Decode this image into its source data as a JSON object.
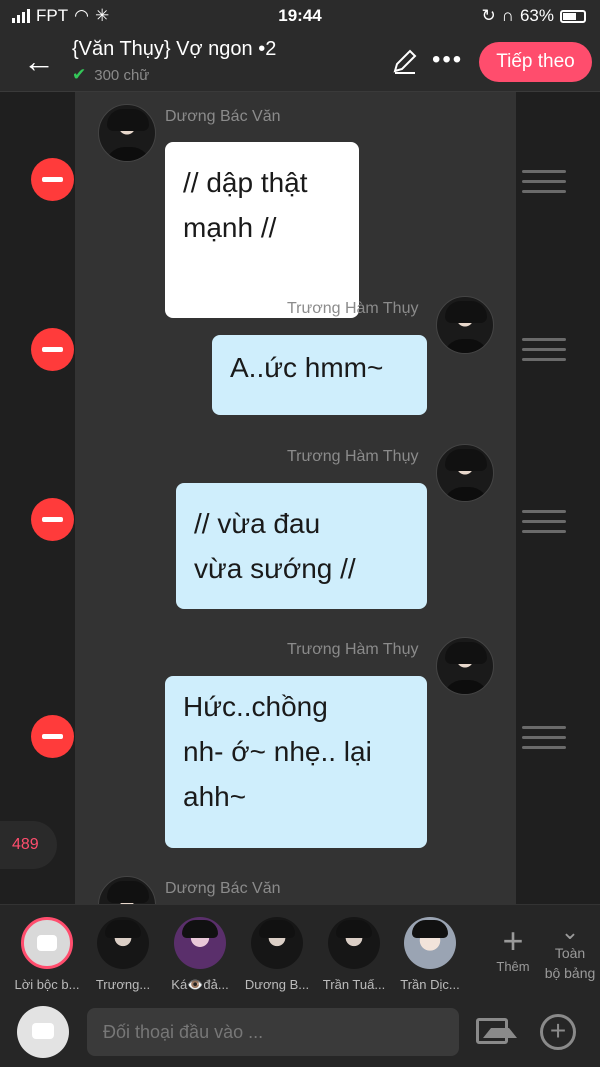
{
  "status": {
    "carrier": "FPT",
    "time": "19:44",
    "battery": "63%"
  },
  "header": {
    "title": "{Văn Thụy} Vợ ngon •2",
    "word_count": "300 chữ",
    "next_label": "Tiếp theo",
    "icons": [
      "back-arrow-icon",
      "pen-icon",
      "more-icon"
    ]
  },
  "messages": [
    {
      "speaker": "Dương Bác Văn",
      "text_lines": [
        "// dập thật",
        "mạnh //"
      ]
    },
    {
      "speaker": "Trương Hàm Thụy",
      "text_lines": [
        "A..ức hmm~"
      ]
    },
    {
      "speaker": "Trương Hàm Thụy",
      "text_lines": [
        "// vừa đau",
        "vừa sướng //"
      ]
    },
    {
      "speaker": "Trương Hàm Thụy",
      "text_lines": [
        "Hức..chồng",
        "nh- ớ~ nhẹ.. lại",
        "ahh~"
      ]
    },
    {
      "speaker": "Dương Bác Văn",
      "text_lines": []
    }
  ],
  "counter": "489",
  "characters": [
    {
      "label": "Lời bộc b..."
    },
    {
      "label": "Trương..."
    },
    {
      "label": "Ká👁️đả..."
    },
    {
      "label": "Dương B..."
    },
    {
      "label": "Trần Tuấ..."
    },
    {
      "label": "Trần Dịc..."
    }
  ],
  "add_label": "Thêm",
  "all_label": [
    "Toàn",
    "bộ bảng"
  ],
  "input": {
    "placeholder": "Đối thoại đầu vào ..."
  },
  "colors": {
    "accent": "#ff4d6d",
    "bubble_left": "#ffffff",
    "bubble_right": "#cfeefc",
    "remove": "#ff3b3b"
  }
}
